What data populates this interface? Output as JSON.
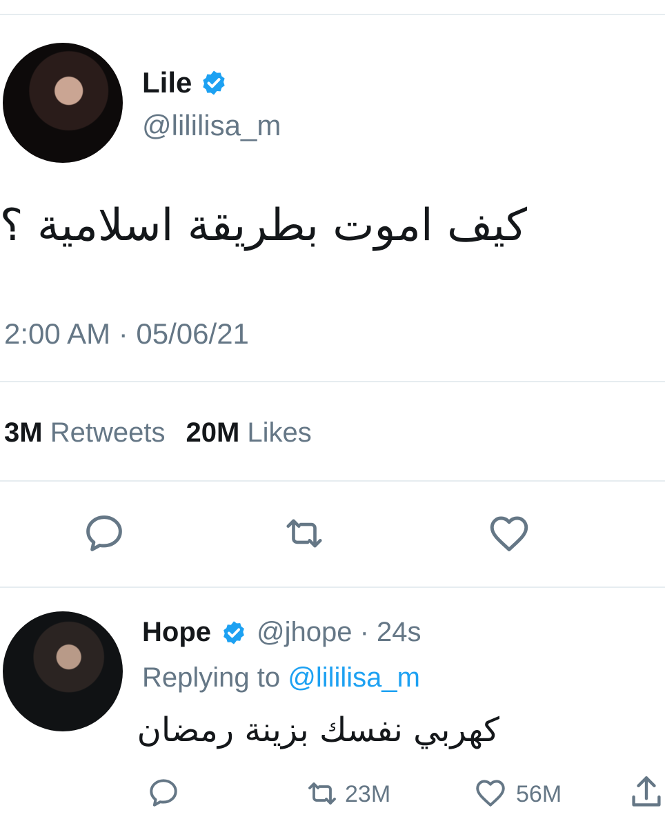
{
  "tweet": {
    "author_name": "Lile",
    "handle": "@lililisa_m",
    "text": "كيف اموت بطريقة اسلامية ؟؟",
    "timestamp": "2:00 AM · 05/06/21",
    "retweets_count": "3M",
    "retweets_label": "Retweets",
    "likes_count": "20M",
    "likes_label": "Likes"
  },
  "reply": {
    "author_name": "Hope",
    "meta": "@jhope · 24s",
    "replying_prefix": "Replying to",
    "replying_handle": "@lililisa_m",
    "text": "كهربي نفسك بزينة رمضان",
    "retweets_count": "23M",
    "likes_count": "56M"
  },
  "icons": {
    "reply": "reply-icon",
    "retweet": "retweet-icon",
    "like": "heart-icon",
    "share": "share-icon",
    "verified": "verified-badge-icon"
  },
  "colors": {
    "verified": "#1da1f2",
    "secondary_text": "#657786",
    "primary_text": "#14171a"
  }
}
